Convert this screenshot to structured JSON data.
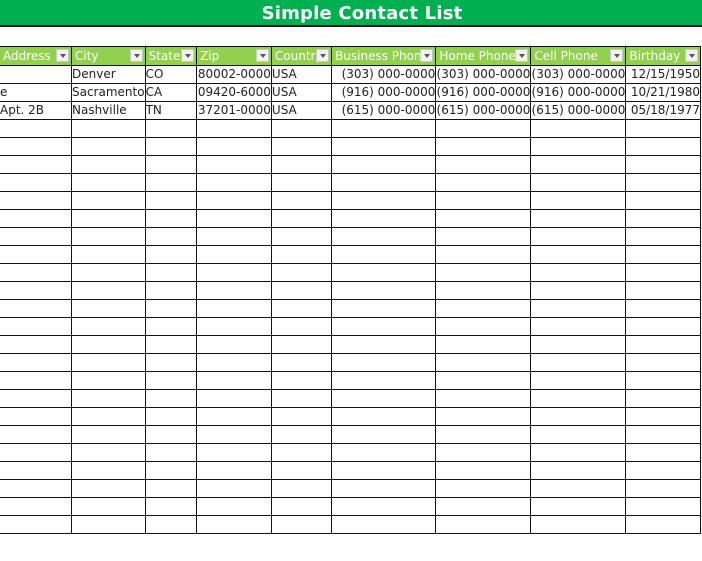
{
  "title": "Simple Contact List",
  "colors": {
    "title_bg": "#00b050",
    "header_bg": "#92d050",
    "header_text": "#ffffff"
  },
  "columns": [
    {
      "key": "address",
      "label": "Address"
    },
    {
      "key": "city",
      "label": "City"
    },
    {
      "key": "state",
      "label": "State"
    },
    {
      "key": "zip",
      "label": "Zip"
    },
    {
      "key": "country",
      "label": "Country"
    },
    {
      "key": "business_phone",
      "label": "Business Phone"
    },
    {
      "key": "home_phone",
      "label": "Home Phone"
    },
    {
      "key": "cell_phone",
      "label": "Cell Phone"
    },
    {
      "key": "birthday",
      "label": "Birthday"
    }
  ],
  "rows": [
    {
      "address": "",
      "city": "Denver",
      "state": "CO",
      "zip": "80002-0000",
      "country": "USA",
      "business_phone": "(303) 000-0000",
      "home_phone": "(303) 000-0000",
      "cell_phone": "(303) 000-0000",
      "birthday": "12/15/1950"
    },
    {
      "address": "e",
      "city": "Sacramento",
      "state": "CA",
      "zip": "09420-6000",
      "country": "USA",
      "business_phone": "(916) 000-0000",
      "home_phone": "(916) 000-0000",
      "cell_phone": "(916) 000-0000",
      "birthday": "10/21/1980"
    },
    {
      "address": "Apt. 2B",
      "city": "Nashville",
      "state": "TN",
      "zip": "37201-0000",
      "country": "USA",
      "business_phone": "(615) 000-0000",
      "home_phone": "(615) 000-0000",
      "cell_phone": "(615) 000-0000",
      "birthday": "05/18/1977"
    }
  ],
  "empty_row_count": 23
}
